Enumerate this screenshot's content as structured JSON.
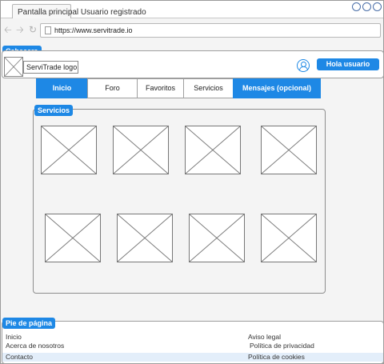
{
  "browser": {
    "tab_title": "Pantalla principal Usuario registrado",
    "url": "https://www.servitrade.io",
    "nav_icons": [
      "back-arrow-icon",
      "forward-arrow-icon",
      "refresh-icon"
    ]
  },
  "header": {
    "label": "Cabecera",
    "logo_text": "ServiTrade logo",
    "user_button": "Hola usuario"
  },
  "menu": {
    "items": [
      "Inicio",
      "Foro",
      "Favoritos",
      "Servicios",
      "Mensajes (opcional)"
    ],
    "active": [
      "Inicio",
      "Mensajes (opcional)"
    ]
  },
  "services": {
    "label": "Servicios",
    "placeholder_count": 8
  },
  "footer": {
    "label": "Pie de página",
    "rows": [
      {
        "left": "Inicio",
        "right": "Aviso legal"
      },
      {
        "left": "Acerca de nosotros",
        "right": "Política de privacidad"
      },
      {
        "left": "Contacto",
        "right": "Política de cookies"
      }
    ]
  },
  "colors": {
    "accent": "#1e88e5",
    "window_button": "#4a6ea8"
  }
}
